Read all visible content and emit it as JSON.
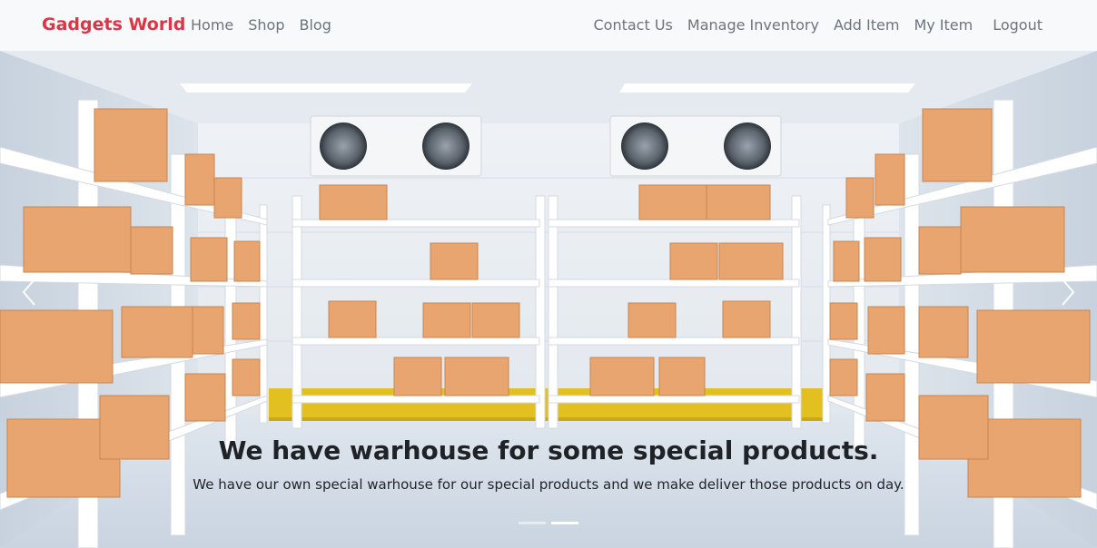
{
  "navbar": {
    "brand": "Gadgets World",
    "left_links": [
      "Home",
      "Shop",
      "Blog"
    ],
    "right_links": [
      "Contact Us",
      "Manage Inventory",
      "Add Item",
      "My Item",
      "Logout"
    ]
  },
  "carousel": {
    "heading": "We have warhouse for some special products.",
    "text": "We have our own special warhouse for our special products and we make deliver those products on day.",
    "slide_count": 2,
    "active_slide": 2,
    "prev_icon": "chevron-left-icon",
    "next_icon": "chevron-right-icon"
  },
  "colors": {
    "brand": "#dc3545",
    "nav_bg": "#f8f9fa",
    "nav_link": "#6c757d",
    "box": "#e8a56f",
    "shelf": "#ffffff",
    "floor_stripe": "#e2c020"
  }
}
